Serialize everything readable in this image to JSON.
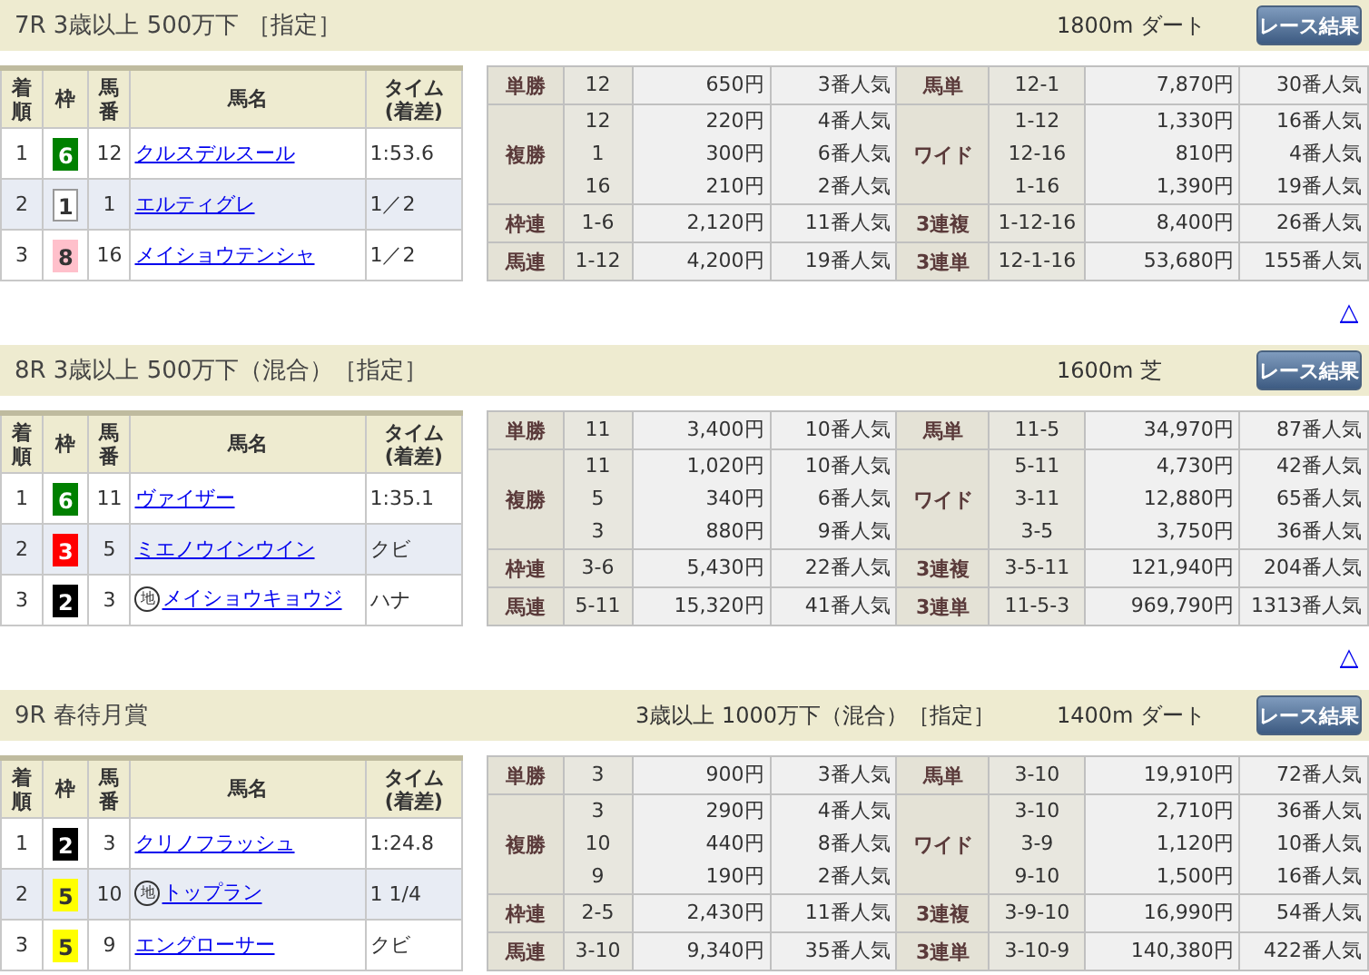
{
  "races": [
    {
      "title": "7R 3歳以上 500万下 ［指定］",
      "course": "1800m ダート",
      "results_button": "レース結果",
      "back_to_top": "△",
      "columns": [
        "着順",
        "枠",
        "馬番",
        "馬名",
        "タイム(着差)"
      ],
      "finishers": [
        {
          "rank": "1",
          "frame": "6",
          "color": "#008000",
          "number": "12",
          "name": "クルスデルスール",
          "time": "1:53.6"
        },
        {
          "rank": "2",
          "frame": "1",
          "color": "#ffffff",
          "number": "1",
          "name": "エルティグレ",
          "time": "1／2"
        },
        {
          "rank": "3",
          "frame": "8",
          "color": "#ffc0cb",
          "number": "16",
          "name": "メイショウテンシャ",
          "time": "1／2"
        }
      ],
      "payouts": [
        {
          "left": {
            "label": "単勝",
            "entries": [
              {
                "combo": "12",
                "amount": "650円",
                "popularity": "3番人気"
              }
            ]
          },
          "right": {
            "label": "馬単",
            "entries": [
              {
                "combo": "12-1",
                "amount": "7,870円",
                "popularity": "30番人気"
              }
            ]
          }
        },
        {
          "left": {
            "label": "複勝",
            "entries": [
              {
                "combo": "12",
                "amount": "220円",
                "popularity": "4番人気"
              },
              {
                "combo": "1",
                "amount": "300円",
                "popularity": "6番人気"
              },
              {
                "combo": "16",
                "amount": "210円",
                "popularity": "2番人気"
              }
            ]
          },
          "right": {
            "label": "ワイド",
            "entries": [
              {
                "combo": "1-12",
                "amount": "1,330円",
                "popularity": "16番人気"
              },
              {
                "combo": "12-16",
                "amount": "810円",
                "popularity": "4番人気"
              },
              {
                "combo": "1-16",
                "amount": "1,390円",
                "popularity": "19番人気"
              }
            ]
          }
        },
        {
          "left": {
            "label": "枠連",
            "entries": [
              {
                "combo": "1-6",
                "amount": "2,120円",
                "popularity": "11番人気"
              }
            ]
          },
          "right": {
            "label": "3連複",
            "entries": [
              {
                "combo": "1-12-16",
                "amount": "8,400円",
                "popularity": "26番人気"
              }
            ]
          }
        },
        {
          "left": {
            "label": "馬連",
            "entries": [
              {
                "combo": "1-12",
                "amount": "4,200円",
                "popularity": "19番人気"
              }
            ]
          },
          "right": {
            "label": "3連単",
            "entries": [
              {
                "combo": "12-1-16",
                "amount": "53,680円",
                "popularity": "155番人気"
              }
            ]
          }
        }
      ]
    },
    {
      "title": "8R 3歳以上 500万下（混合）［指定］",
      "course": "1600m 芝",
      "results_button": "レース結果",
      "back_to_top": "△",
      "columns": [
        "着順",
        "枠",
        "馬番",
        "馬名",
        "タイム(着差)"
      ],
      "finishers": [
        {
          "rank": "1",
          "frame": "6",
          "color": "#008000",
          "number": "11",
          "name": "ヴァイザー",
          "time": "1:35.1"
        },
        {
          "rank": "2",
          "frame": "3",
          "color": "#ff0000",
          "number": "5",
          "name": "ミエノウインウイン",
          "time": "クビ"
        },
        {
          "rank": "3",
          "frame": "2",
          "color": "#000000",
          "number": "3",
          "local_mark": "地",
          "name": "メイショウキョウジ",
          "time": "ハナ"
        }
      ],
      "payouts": [
        {
          "left": {
            "label": "単勝",
            "entries": [
              {
                "combo": "11",
                "amount": "3,400円",
                "popularity": "10番人気"
              }
            ]
          },
          "right": {
            "label": "馬単",
            "entries": [
              {
                "combo": "11-5",
                "amount": "34,970円",
                "popularity": "87番人気"
              }
            ]
          }
        },
        {
          "left": {
            "label": "複勝",
            "entries": [
              {
                "combo": "11",
                "amount": "1,020円",
                "popularity": "10番人気"
              },
              {
                "combo": "5",
                "amount": "340円",
                "popularity": "6番人気"
              },
              {
                "combo": "3",
                "amount": "880円",
                "popularity": "9番人気"
              }
            ]
          },
          "right": {
            "label": "ワイド",
            "entries": [
              {
                "combo": "5-11",
                "amount": "4,730円",
                "popularity": "42番人気"
              },
              {
                "combo": "3-11",
                "amount": "12,880円",
                "popularity": "65番人気"
              },
              {
                "combo": "3-5",
                "amount": "3,750円",
                "popularity": "36番人気"
              }
            ]
          }
        },
        {
          "left": {
            "label": "枠連",
            "entries": [
              {
                "combo": "3-6",
                "amount": "5,430円",
                "popularity": "22番人気"
              }
            ]
          },
          "right": {
            "label": "3連複",
            "entries": [
              {
                "combo": "3-5-11",
                "amount": "121,940円",
                "popularity": "204番人気"
              }
            ]
          }
        },
        {
          "left": {
            "label": "馬連",
            "entries": [
              {
                "combo": "5-11",
                "amount": "15,320円",
                "popularity": "41番人気"
              }
            ]
          },
          "right": {
            "label": "3連単",
            "entries": [
              {
                "combo": "11-5-3",
                "amount": "969,790円",
                "popularity": "1313番人気"
              }
            ]
          }
        }
      ]
    },
    {
      "title": "9R 春待月賞",
      "conditions": "3歳以上 1000万下（混合）［指定］",
      "course": "1400m ダート",
      "results_button": "レース結果",
      "columns": [
        "着順",
        "枠",
        "馬番",
        "馬名",
        "タイム(着差)"
      ],
      "finishers": [
        {
          "rank": "1",
          "frame": "2",
          "color": "#000000",
          "number": "3",
          "name": "クリノフラッシュ",
          "time": "1:24.8"
        },
        {
          "rank": "2",
          "frame": "5",
          "color": "#ffff00",
          "number": "10",
          "local_mark": "地",
          "name": "トップラン",
          "time": "1 1/4"
        },
        {
          "rank": "3",
          "frame": "5",
          "color": "#ffff00",
          "number": "9",
          "name": "エングローサー",
          "time": "クビ"
        }
      ],
      "payouts": [
        {
          "left": {
            "label": "単勝",
            "entries": [
              {
                "combo": "3",
                "amount": "900円",
                "popularity": "3番人気"
              }
            ]
          },
          "right": {
            "label": "馬単",
            "entries": [
              {
                "combo": "3-10",
                "amount": "19,910円",
                "popularity": "72番人気"
              }
            ]
          }
        },
        {
          "left": {
            "label": "複勝",
            "entries": [
              {
                "combo": "3",
                "amount": "290円",
                "popularity": "4番人気"
              },
              {
                "combo": "10",
                "amount": "440円",
                "popularity": "8番人気"
              },
              {
                "combo": "9",
                "amount": "190円",
                "popularity": "2番人気"
              }
            ]
          },
          "right": {
            "label": "ワイド",
            "entries": [
              {
                "combo": "3-10",
                "amount": "2,710円",
                "popularity": "36番人気"
              },
              {
                "combo": "3-9",
                "amount": "1,120円",
                "popularity": "10番人気"
              },
              {
                "combo": "9-10",
                "amount": "1,500円",
                "popularity": "16番人気"
              }
            ]
          }
        },
        {
          "left": {
            "label": "枠連",
            "entries": [
              {
                "combo": "2-5",
                "amount": "2,430円",
                "popularity": "11番人気"
              }
            ]
          },
          "right": {
            "label": "3連複",
            "entries": [
              {
                "combo": "3-9-10",
                "amount": "16,990円",
                "popularity": "54番人気"
              }
            ]
          }
        },
        {
          "left": {
            "label": "馬連",
            "entries": [
              {
                "combo": "3-10",
                "amount": "9,340円",
                "popularity": "35番人気"
              }
            ]
          },
          "right": {
            "label": "3連単",
            "entries": [
              {
                "combo": "3-10-9",
                "amount": "140,380円",
                "popularity": "422番人気"
              }
            ]
          }
        }
      ]
    }
  ]
}
